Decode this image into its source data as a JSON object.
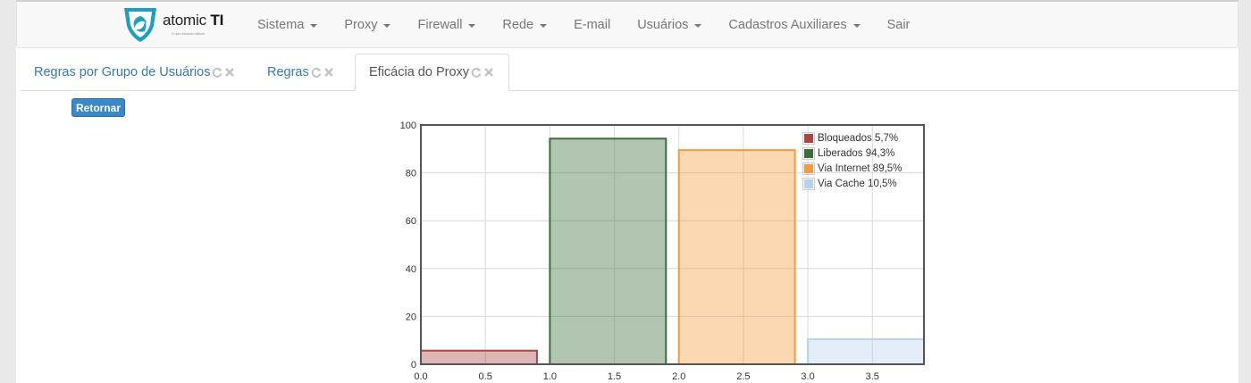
{
  "brand": {
    "name": "atomic",
    "name_bold": "TI",
    "tagline": "O seu escudo virtual"
  },
  "nav": {
    "items": [
      {
        "label": "Sistema",
        "dropdown": true
      },
      {
        "label": "Proxy",
        "dropdown": true
      },
      {
        "label": "Firewall",
        "dropdown": true
      },
      {
        "label": "Rede",
        "dropdown": true
      },
      {
        "label": "E-mail",
        "dropdown": false
      },
      {
        "label": "Usuários",
        "dropdown": true
      },
      {
        "label": "Cadastros Auxiliares",
        "dropdown": true
      },
      {
        "label": "Sair",
        "dropdown": false
      }
    ]
  },
  "tabs": [
    {
      "label": "Regras por Grupo de Usuários",
      "active": false
    },
    {
      "label": "Regras",
      "active": false
    },
    {
      "label": "Eficácia do Proxy",
      "active": true
    }
  ],
  "buttons": {
    "back": "Retornar"
  },
  "colors": {
    "accent": "#337ab7",
    "button": "#3a88c8"
  },
  "chart_data": {
    "type": "bar",
    "title": "",
    "xlabel": "",
    "ylabel": "",
    "xlim": [
      0,
      3.9
    ],
    "ylim": [
      0,
      100
    ],
    "xticks": [
      "0.0",
      "0.5",
      "1.0",
      "1.5",
      "2.0",
      "2.5",
      "3.0",
      "3.5"
    ],
    "yticks": [
      "0",
      "20",
      "40",
      "60",
      "80",
      "100"
    ],
    "grid": true,
    "legend_position": "top-right",
    "bar_width": 0.9,
    "series": [
      {
        "name": "Bloqueados 5,7%",
        "x": 0,
        "value": 5.7,
        "color": "#aa4643"
      },
      {
        "name": "Liberados 94,3%",
        "x": 1,
        "value": 94.3,
        "color": "#3d6e3a"
      },
      {
        "name": "Via Internet 89,5%",
        "x": 2,
        "value": 89.5,
        "color": "#f59a3e"
      },
      {
        "name": "Via Cache 10,5%",
        "x": 3,
        "value": 10.5,
        "color": "#b7d2ee"
      }
    ]
  }
}
